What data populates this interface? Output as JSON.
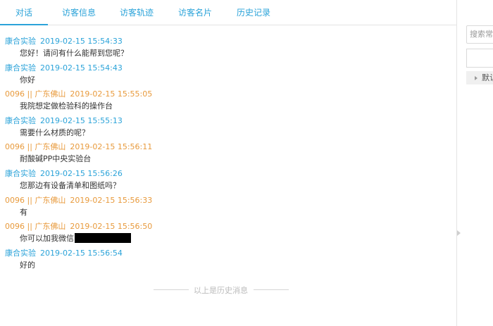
{
  "tabs": [
    {
      "label": "对话",
      "active": true
    },
    {
      "label": "访客信息",
      "active": false
    },
    {
      "label": "访客轨迹",
      "active": false
    },
    {
      "label": "访客名片",
      "active": false
    },
    {
      "label": "历史记录",
      "active": false
    }
  ],
  "messages": [
    {
      "role": "agent",
      "name": "康合实验",
      "time": "2019-02-15 15:54:33",
      "text": "您好！请问有什么能帮到您呢？"
    },
    {
      "role": "agent",
      "name": "康合实验",
      "time": "2019-02-15 15:54:43",
      "text": "你好"
    },
    {
      "role": "visitor",
      "name": "0096 || 广东佛山",
      "time": "2019-02-15 15:55:05",
      "text": "我院想定做检验科的操作台"
    },
    {
      "role": "agent",
      "name": "康合实验",
      "time": "2019-02-15 15:55:13",
      "text": "需要什么材质的呢？"
    },
    {
      "role": "visitor",
      "name": "0096 || 广东佛山",
      "time": "2019-02-15 15:56:11",
      "text": "耐酸碱PP中央实验台"
    },
    {
      "role": "agent",
      "name": "康合实验",
      "time": "2019-02-15 15:56:26",
      "text": "您那边有设备清单和图纸吗？"
    },
    {
      "role": "visitor",
      "name": "0096 || 广东佛山",
      "time": "2019-02-15 15:56:33",
      "text": "有"
    },
    {
      "role": "visitor",
      "name": "0096 || 广东佛山",
      "time": "2019-02-15 15:56:50",
      "text": "你可以加我微信",
      "redacted": true
    },
    {
      "role": "agent",
      "name": "康合实验",
      "time": "2019-02-15 15:56:54",
      "text": "好的"
    }
  ],
  "history_divider": "以上是历史消息",
  "right_panel": {
    "search_placeholder": "搜索常用",
    "default_label": "默认"
  },
  "colors": {
    "agent": "#2ba3d9",
    "visitor": "#e89a3c",
    "tab_accent": "#2ba3d9"
  }
}
